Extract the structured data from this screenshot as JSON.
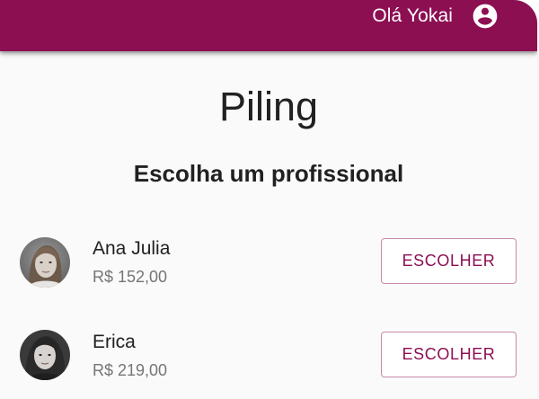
{
  "header": {
    "greeting": "Olá Yokai",
    "account_icon": "account-circle-icon",
    "background_color": "#8c0f52"
  },
  "page": {
    "title": "Piling",
    "subtitle": "Escolha um profissional"
  },
  "professionals": [
    {
      "name": "Ana Julia",
      "price": "R$ 152,00",
      "button_label": "ESCOLHER"
    },
    {
      "name": "Erica",
      "price": "R$ 219,00",
      "button_label": "ESCOLHER"
    }
  ],
  "colors": {
    "accent": "#8c0f52",
    "button_border": "#c58aa7",
    "price_text": "#757575"
  }
}
